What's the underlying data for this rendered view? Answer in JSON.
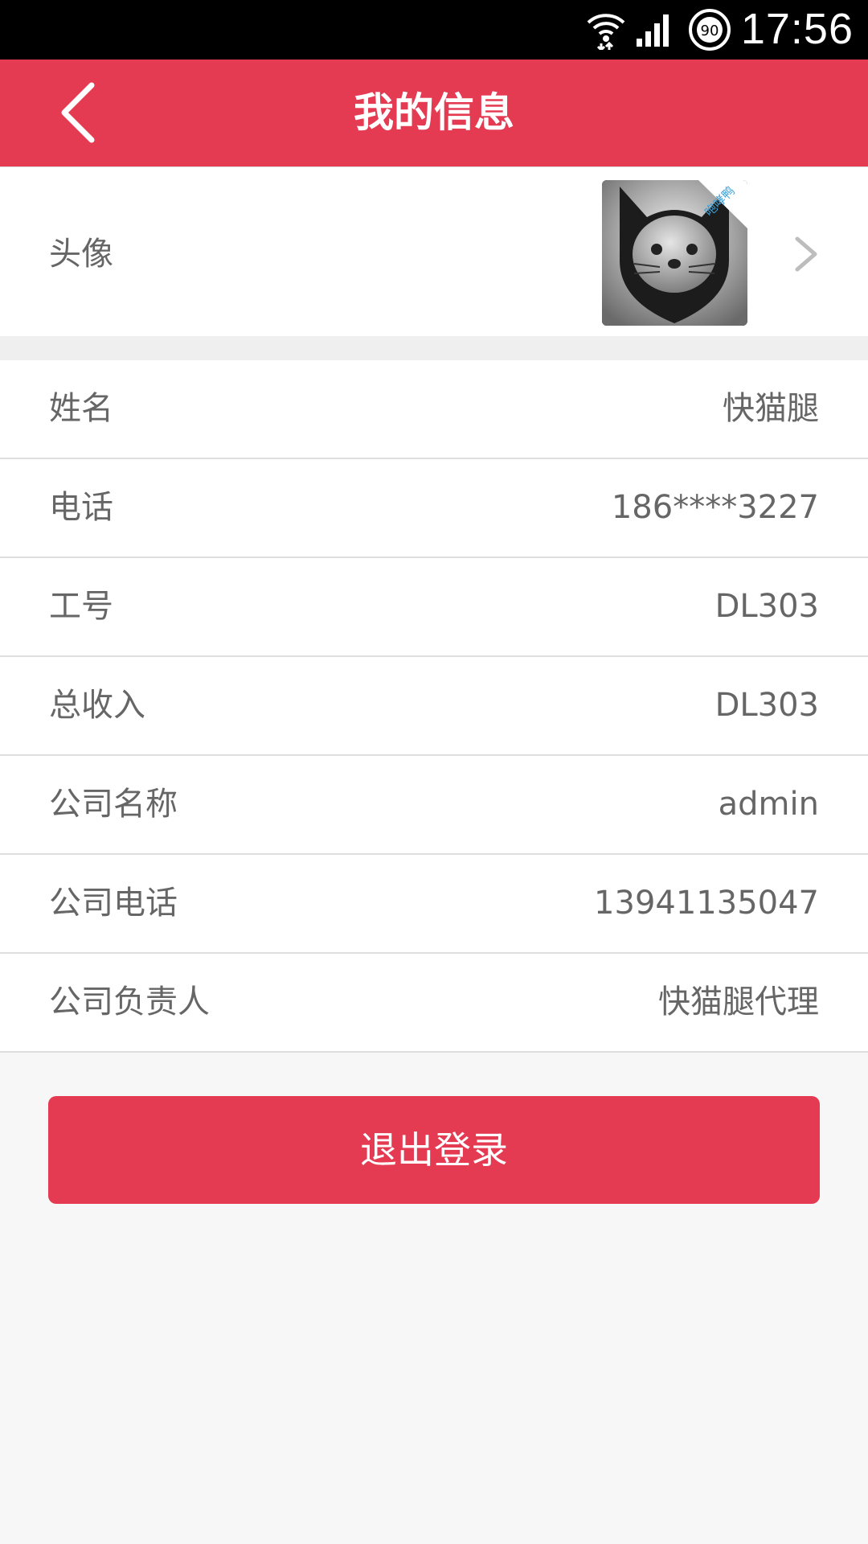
{
  "status_bar": {
    "time": "17:56",
    "badge": "90"
  },
  "header": {
    "title": "我的信息"
  },
  "avatar_row": {
    "label": "头像",
    "avatar_badge": "咆哮鸭"
  },
  "info_rows": [
    {
      "label": "姓名",
      "value": "快猫腿"
    },
    {
      "label": "电话",
      "value": "186****3227"
    },
    {
      "label": "工号",
      "value": "DL303"
    },
    {
      "label": "总收入",
      "value": "DL303"
    },
    {
      "label": "公司名称",
      "value": "admin"
    },
    {
      "label": "公司电话",
      "value": "13941135047"
    },
    {
      "label": "公司负责人",
      "value": "快猫腿代理"
    }
  ],
  "logout_label": "退出登录",
  "colors": {
    "primary": "#e43a52",
    "text": "#666666",
    "divider": "#dedede"
  }
}
